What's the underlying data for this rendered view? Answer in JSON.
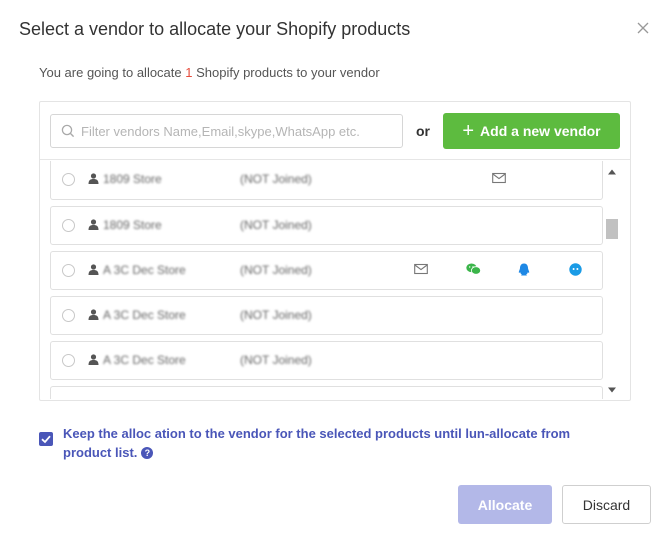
{
  "dialog": {
    "title": "Select a vendor to allocate your Shopify products",
    "subtitle_prefix": "You are going to allocate ",
    "product_count": "1",
    "subtitle_suffix": " Shopify products to your vendor"
  },
  "search": {
    "placeholder": "Filter vendors Name,Email,skype,WhatsApp etc.",
    "value": ""
  },
  "or_label": "or",
  "add_vendor_label": "Add a new vendor",
  "vendors": [
    {
      "name": "1809 Store",
      "status": "(NOT Joined)",
      "channels": [
        "email-icon"
      ]
    },
    {
      "name": "1809 Store",
      "status": "(NOT Joined)",
      "channels": []
    },
    {
      "name": "A 3C Dec Store",
      "status": "(NOT Joined)",
      "channels": [
        "email-icon",
        "wechat-icon",
        "qq-icon",
        "skype-icon"
      ]
    },
    {
      "name": "A 3C Dec Store",
      "status": "(NOT Joined)",
      "channels": []
    },
    {
      "name": "A 3C Dec Store",
      "status": "(NOT Joined)",
      "channels": []
    }
  ],
  "keep_allocation": {
    "checked": true,
    "label": "Keep the alloc ation to the vendor for the selected products until lun-allocate from product list.",
    "help": "?"
  },
  "buttons": {
    "allocate": "Allocate",
    "discard": "Discard"
  },
  "colors": {
    "accent": "#4a56b8",
    "add_button": "#5dbb3f",
    "allocate_disabled": "#b3b8e8",
    "count": "#e74c3c",
    "wechat": "#3bb54a",
    "qq": "#1e88e5",
    "skype": "#1a9be6"
  }
}
